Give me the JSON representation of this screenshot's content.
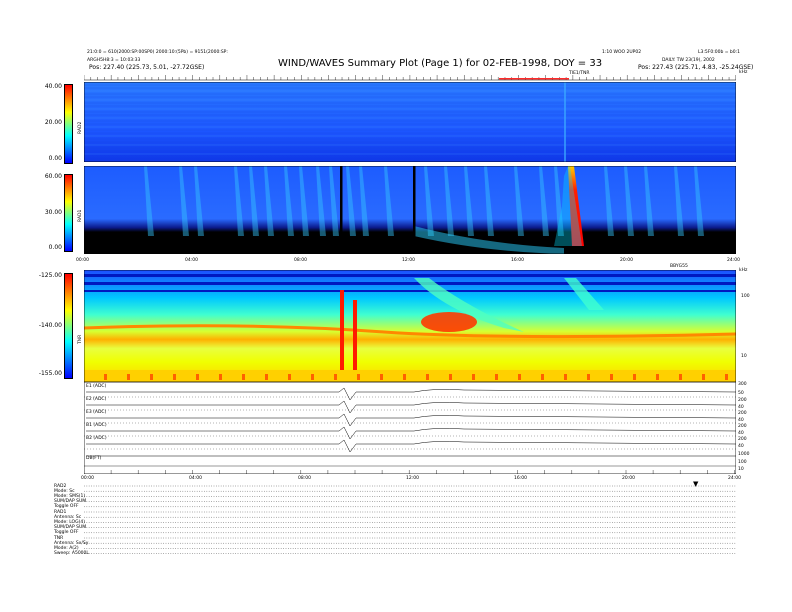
{
  "header": {
    "title": "WIND/WAVES Summary Plot (Page 1) for 02-FEB-1998, DOY = 33",
    "left_line1": "21:0:0 = 610(2000:SP:00SP0) 2000:10:(5Pb) = 9151(2000:SP:",
    "left_line2": "ARGH5H8:3 = 10:03:33",
    "left_pos": "Pos:  227.40 (225.73, 5.01, -27.72GSE)",
    "right_line1": "1:10 WOO 2UP02",
    "right_line2": "L3:5F0:00b = b0:1",
    "right_line3": "DAILY: TW 23(19), 2002",
    "right_pos": "Pos:  227.43 (225.71, 4.83, -25.24GSE)",
    "top_axis_label": "TIE1/TNR",
    "right_corner": "kHz"
  },
  "colors": {
    "cb_min": "#0000ff",
    "cb_mid1": "#00ffff",
    "cb_mid2": "#ffff00",
    "cb_max": "#ff0000",
    "background_blue": "#1a4cff",
    "quiet_black": "#000000"
  },
  "chart_data": [
    {
      "type": "heatmap",
      "panel": "RAD2",
      "ylabel": "RAD2",
      "colorbar_ticks": [
        "40.00",
        "20.00",
        "0.00"
      ],
      "colorbar_range": [
        0,
        40
      ],
      "x_range_hours": [
        0,
        24
      ],
      "events_hours": [
        13.5,
        18.7
      ]
    },
    {
      "type": "heatmap",
      "panel": "RAD1",
      "ylabel": "RAD1",
      "colorbar_ticks": [
        "60.00",
        "30.00",
        "0.00"
      ],
      "colorbar_range": [
        0,
        60
      ],
      "x_ticks": [
        "00:00",
        "04:00",
        "08:00",
        "12:00",
        "16:00",
        "20:00",
        "24:00"
      ],
      "strong_burst_hour": 18.5,
      "dark_streaks_hours": [
        9.4,
        12.4
      ]
    },
    {
      "type": "heatmap",
      "panel": "TNR",
      "ylabel": "TNR",
      "colorbar_ticks": [
        "-125.00",
        "-140.00",
        "-155.00"
      ],
      "colorbar_range": [
        -155,
        -125
      ],
      "right_axis_ticks": [
        "100",
        "10"
      ],
      "right_axis_label": "kHz",
      "top_right_label": "BBYG55",
      "spike_hours": [
        9.55,
        10.0
      ],
      "plasma_line_level": -140
    },
    {
      "type": "line",
      "panel": "housekeeping",
      "series_labels": [
        "E1 (ADC)",
        "E2 (ADC)",
        "E3 (ADC)",
        "B1 (ADC)",
        "B2 (ADC)",
        "DB(FT)"
      ],
      "right_ticks": [
        [
          "300",
          "50"
        ],
        [
          "200",
          "40"
        ],
        [
          "200",
          "40"
        ],
        [
          "200",
          "40"
        ],
        [
          "200",
          "40"
        ],
        [
          "1000",
          "100",
          "10"
        ]
      ],
      "x_ticks": [
        "00:00",
        "04:00",
        "08:00",
        "12:00",
        "16:00",
        "20:00",
        "24:00"
      ],
      "marker_hour": 22.5
    }
  ],
  "footer": {
    "rad2_block": [
      "RAD2",
      "Mode:  Sc",
      "Mode:  SMS(1)",
      "SUM/DAP SUM",
      "Toggle  OFF"
    ],
    "rad1_block": [
      "RAD1",
      "Antenna:  Sc",
      "Mode:  LOG(4)",
      "SUM/DAP SUM",
      "Toggle  OFF"
    ],
    "tnr_block": [
      "TNR",
      "Antenna:  Sx/Sy",
      "Mode:  A(2)",
      "Sweep:  A5000L"
    ]
  }
}
